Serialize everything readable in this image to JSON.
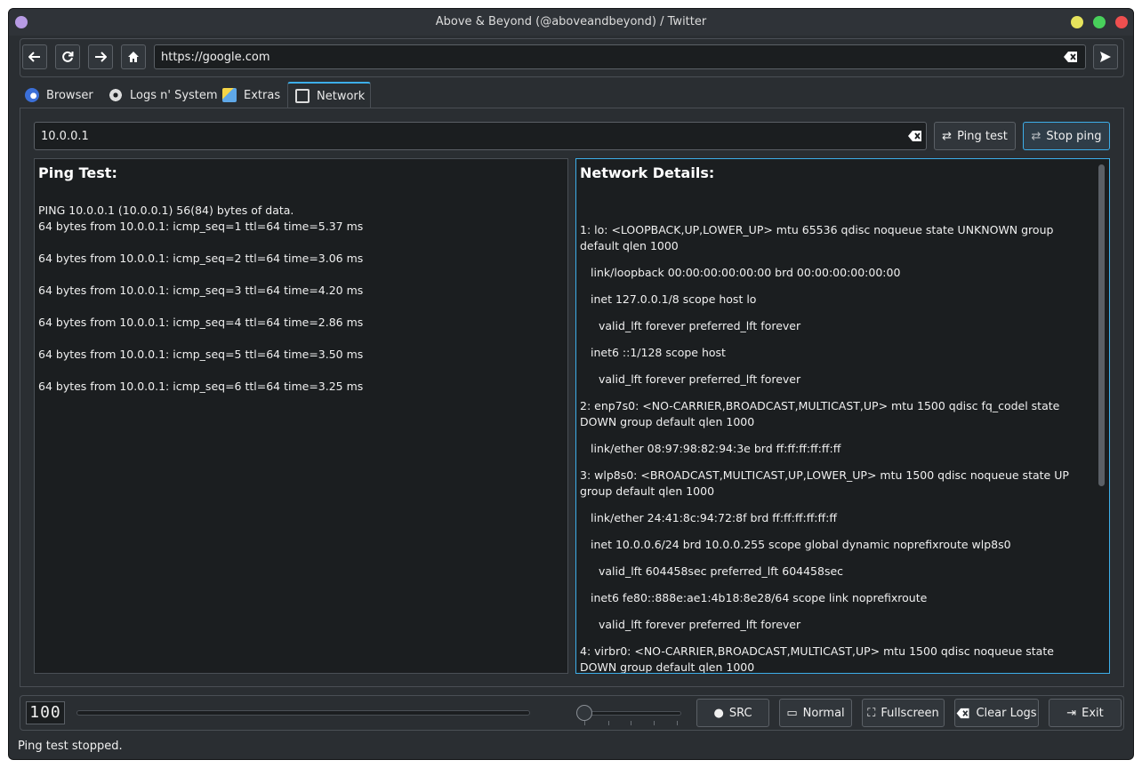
{
  "window": {
    "title": "Above & Beyond (@aboveandbeyond) / Twitter"
  },
  "nav": {
    "back_icon": "arrow-left-icon",
    "reload_icon": "reload-icon",
    "forward_icon": "arrow-right-icon",
    "home_icon": "home-icon",
    "url": "https://google.com",
    "go_icon": "send-icon"
  },
  "tabs": [
    {
      "label": "Browser",
      "icon": "browser-icon",
      "active": false
    },
    {
      "label": "Logs n' System",
      "icon": "gear-icon",
      "active": false
    },
    {
      "label": "Extras",
      "icon": "notepad-icon",
      "active": false
    },
    {
      "label": "Network",
      "icon": "network-icon",
      "active": true
    }
  ],
  "network": {
    "host_value": "10.0.0.1",
    "ping_button": "Ping test",
    "stop_button": "Stop ping",
    "ping_panel": {
      "title": "Ping Test:",
      "header": "PING 10.0.0.1 (10.0.0.1) 56(84) bytes of data.",
      "lines": [
        "64 bytes from 10.0.0.1: icmp_seq=1 ttl=64 time=5.37 ms",
        "64 bytes from 10.0.0.1: icmp_seq=2 ttl=64 time=3.06 ms",
        "64 bytes from 10.0.0.1: icmp_seq=3 ttl=64 time=4.20 ms",
        "64 bytes from 10.0.0.1: icmp_seq=4 ttl=64 time=2.86 ms",
        "64 bytes from 10.0.0.1: icmp_seq=5 ttl=64 time=3.50 ms",
        "64 bytes from 10.0.0.1: icmp_seq=6 ttl=64 time=3.25 ms"
      ]
    },
    "details_panel": {
      "title": "Network Details:",
      "lines": [
        {
          "indent": 0,
          "text": "1: lo: <LOOPBACK,UP,LOWER_UP> mtu 65536 qdisc noqueue state UNKNOWN group default qlen 1000"
        },
        {
          "indent": 1,
          "text": "link/loopback 00:00:00:00:00:00 brd 00:00:00:00:00:00"
        },
        {
          "indent": 1,
          "text": "inet 127.0.0.1/8 scope host lo"
        },
        {
          "indent": 2,
          "text": "valid_lft forever preferred_lft forever"
        },
        {
          "indent": 1,
          "text": "inet6 ::1/128 scope host"
        },
        {
          "indent": 2,
          "text": "valid_lft forever preferred_lft forever"
        },
        {
          "indent": 0,
          "text": "2: enp7s0: <NO-CARRIER,BROADCAST,MULTICAST,UP> mtu 1500 qdisc fq_codel state DOWN group default qlen 1000"
        },
        {
          "indent": 1,
          "text": "link/ether 08:97:98:82:94:3e brd ff:ff:ff:ff:ff:ff"
        },
        {
          "indent": 0,
          "text": "3: wlp8s0: <BROADCAST,MULTICAST,UP,LOWER_UP> mtu 1500 qdisc noqueue state UP group default qlen 1000"
        },
        {
          "indent": 1,
          "text": "link/ether 24:41:8c:94:72:8f brd ff:ff:ff:ff:ff:ff"
        },
        {
          "indent": 1,
          "text": "inet 10.0.0.6/24 brd 10.0.0.255 scope global dynamic noprefixroute wlp8s0"
        },
        {
          "indent": 2,
          "text": "valid_lft 604458sec preferred_lft 604458sec"
        },
        {
          "indent": 1,
          "text": "inet6 fe80::888e:ae1:4b18:8e28/64 scope link noprefixroute"
        },
        {
          "indent": 2,
          "text": "valid_lft forever preferred_lft forever"
        },
        {
          "indent": 0,
          "text": "4: virbr0: <NO-CARRIER,BROADCAST,MULTICAST,UP> mtu 1500 qdisc noqueue state DOWN group default qlen 1000"
        }
      ]
    }
  },
  "bottom": {
    "lcd_value": "100",
    "progress": 0,
    "slider_value": 0,
    "src_button": "SRC",
    "src_icon": "github-icon",
    "normal_button": "Normal",
    "normal_icon": "window-normal-icon",
    "fullscreen_button": "Fullscreen",
    "fullscreen_icon": "fullscreen-icon",
    "clear_logs_button": "Clear Logs",
    "clear_logs_icon": "backspace-icon",
    "exit_button": "Exit",
    "exit_icon": "exit-icon"
  },
  "status": "Ping test stopped.",
  "colors": {
    "accent": "#3daee9",
    "window_bg": "#2a2e32",
    "panel_bg": "#1b1e20"
  }
}
